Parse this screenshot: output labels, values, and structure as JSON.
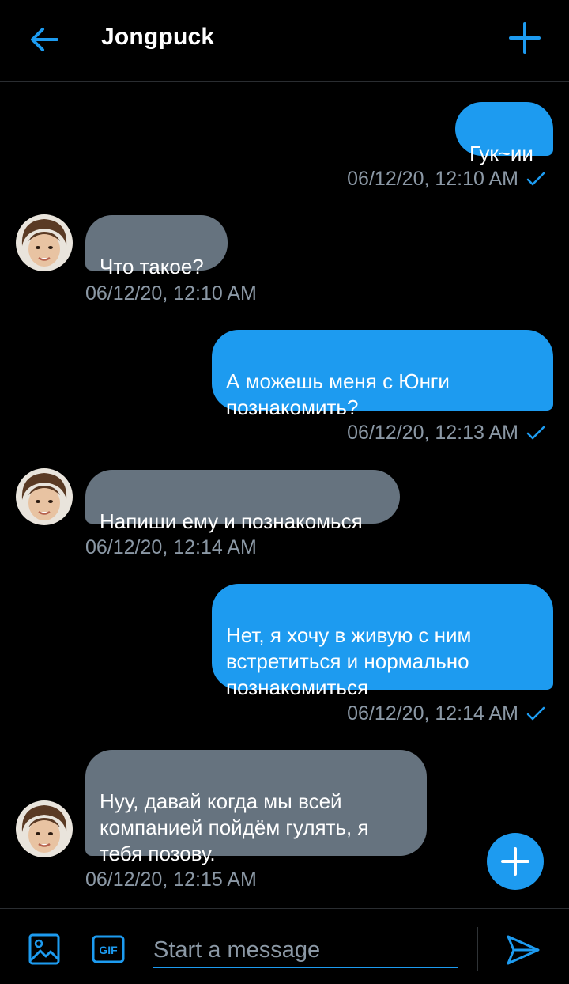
{
  "header": {
    "title": "Jongpuck",
    "back_icon": "arrow-left-icon",
    "add_icon": "plus-icon"
  },
  "accent_color": "#1d9bf0",
  "messages": [
    {
      "direction": "outgoing",
      "text": "Гук~ии",
      "timestamp": "06/12/20, 12:10 AM",
      "status": "sent-check"
    },
    {
      "direction": "incoming",
      "text": "Что такое?",
      "timestamp": "06/12/20, 12:10 AM"
    },
    {
      "direction": "outgoing",
      "text": "А можешь меня с Юнги\nпознакомить?",
      "timestamp": "06/12/20, 12:13 AM",
      "status": "sent-check"
    },
    {
      "direction": "incoming",
      "text": "Напиши ему и познакомься",
      "timestamp": "06/12/20, 12:14 AM"
    },
    {
      "direction": "outgoing",
      "text": "Нет, я хочу в живую с ним\nвстретиться и нормально\nпознакомиться",
      "timestamp": "06/12/20, 12:14 AM",
      "status": "sent-check"
    },
    {
      "direction": "incoming",
      "text": "Нуу, давай когда мы всей\nкомпанией пойдём гулять, я\nтебя позову.",
      "timestamp": "06/12/20, 12:15 AM"
    }
  ],
  "composer": {
    "placeholder": "Start a message",
    "image_icon": "image-icon",
    "gif_label": "GIF",
    "send_icon": "send-icon"
  }
}
